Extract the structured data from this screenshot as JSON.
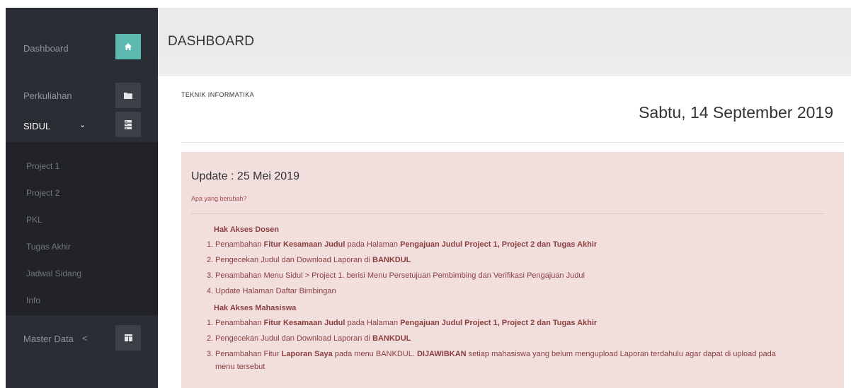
{
  "sidebar": {
    "dashboard_label": "Dashboard",
    "perkuliahan_label": "Perkuliahan",
    "sidul_label": "SIDUL",
    "sidul_chevron": "⌄",
    "submenu": [
      "Project 1",
      "Project 2",
      "PKL",
      "Tugas Akhir",
      "Jadwal Sidang",
      "Info"
    ],
    "master_data_label": "Master Data",
    "master_data_chevron": "<",
    "icons": {
      "dashboard": "home-icon",
      "perkuliahan": "folder-icon",
      "sidul": "server-icon",
      "master_data": "table-icon"
    },
    "colors": {
      "background": "#2a2d33",
      "submenu_background": "#212328",
      "active_icon_bg": "#5cb9ad"
    }
  },
  "header": {
    "title": "DASHBOARD"
  },
  "panel": {
    "org": "TEKNIK INFORMATIKA",
    "date": "Sabtu, 14 September 2019"
  },
  "update": {
    "title": "Update : 25 Mei 2019",
    "subtitle": "Apa yang berubah?",
    "dosen": {
      "heading": "Hak Akses Dosen",
      "items": [
        {
          "num": "1.",
          "t1": "Penambahan ",
          "b1": "Fitur Kesamaan Judul",
          "t2": " pada Halaman ",
          "b2": "Pengajuan Judul Project 1, Project 2 dan Tugas Akhir"
        },
        {
          "num": "2.",
          "t1": "Pengecekan Judul dan Download Laporan di ",
          "b1": "BANKDUL"
        },
        {
          "num": "3.",
          "t1": "Penambahan Menu Sidul > Project 1. berisi Menu Persetujuan Pembimbing dan Verifikasi Pengajuan Judul"
        },
        {
          "num": "4.",
          "t1": "Update Halaman Daftar Bimbingan"
        }
      ]
    },
    "mahasiswa": {
      "heading": "Hak Akses Mahasiswa",
      "items": [
        {
          "num": "1.",
          "t1": "Penambahan ",
          "b1": "Fitur Kesamaan Judul",
          "t2": " pada Halaman ",
          "b2": "Pengajuan Judul Project 1, Project 2 dan Tugas Akhir"
        },
        {
          "num": "2.",
          "t1": "Pengecekan Judul dan Download Laporan di ",
          "b1": "BANKDUL"
        },
        {
          "num": "3.",
          "t1": "Penambahan Fitur ",
          "b1": "Laporan Saya",
          "t2": " pada menu BANKDUL. ",
          "b2": "DIJAWIBKAN",
          "t3": " setiap mahasiswa yang belum mengupload Laporan terdahulu agar dapat di upload pada",
          "t4": "menu tersebut"
        }
      ]
    },
    "colors": {
      "alert_background": "#f3dede",
      "alert_text": "#8a3f3f"
    }
  }
}
